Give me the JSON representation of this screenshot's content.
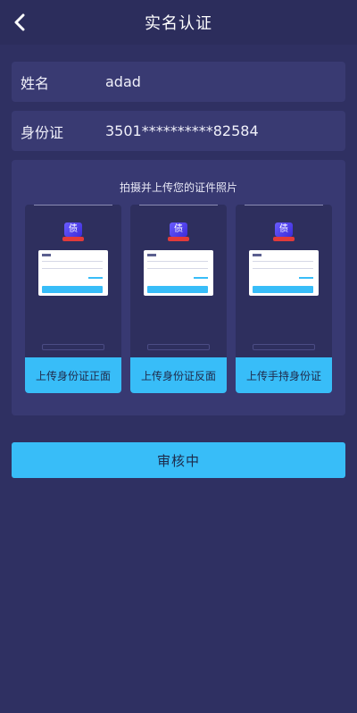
{
  "header": {
    "title": "实名认证"
  },
  "form": {
    "name_label": "姓名",
    "name_value": "adad",
    "id_label": "身份证",
    "id_value": "3501**********82584"
  },
  "upload": {
    "hint": "拍摄并上传您的证件照片",
    "cards": [
      {
        "label": "上传身份证正面"
      },
      {
        "label": "上传身份证反面"
      },
      {
        "label": "上传手持身份证"
      }
    ]
  },
  "actions": {
    "submit_label": "审核中"
  }
}
